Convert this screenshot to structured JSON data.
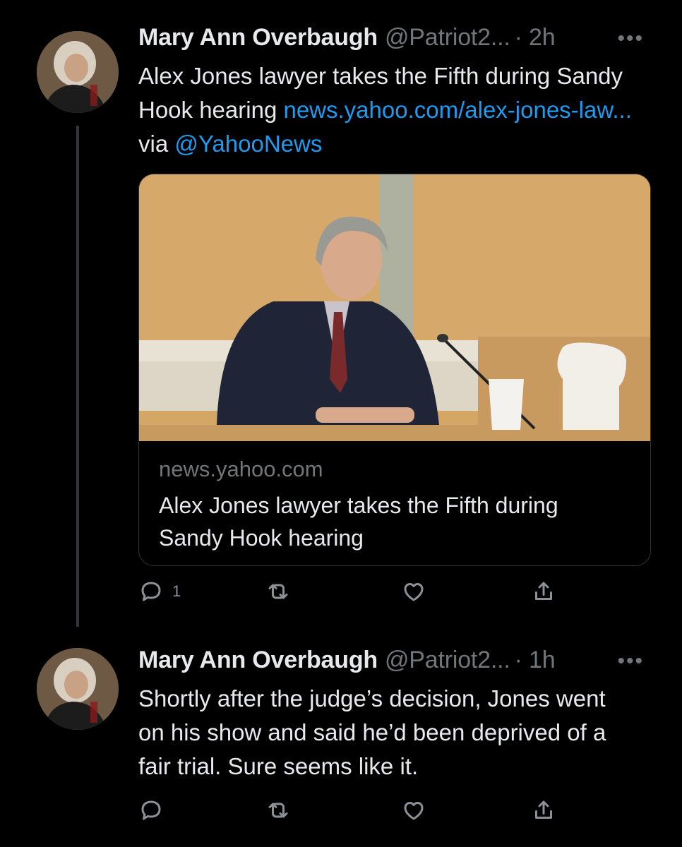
{
  "tweets": [
    {
      "author_name": "Mary Ann Overbaugh",
      "handle": "@Patriot2...",
      "time": "· 2h",
      "more": "•••",
      "text_1": "Alex Jones lawyer takes the Fifth during Sandy Hook hearing ",
      "link_1": "news.yahoo.com/alex-jones-law...",
      "text_2": " via ",
      "mention": "@YahooNews",
      "card": {
        "domain": "news.yahoo.com",
        "title": "Alex Jones lawyer takes the Fifth during Sandy Hook hearing"
      },
      "actions": {
        "reply_count": "1"
      }
    },
    {
      "author_name": "Mary Ann Overbaugh",
      "handle": "@Patriot2...",
      "time": "· 1h",
      "more": "•••",
      "text": "Shortly after the judge’s decision, Jones went on his show and said he’d been deprived of a fair trial. Sure seems like it."
    }
  ],
  "icons": [
    "reply-icon",
    "retweet-icon",
    "like-icon",
    "share-icon",
    "more-icon"
  ],
  "colors": {
    "background": "#000000",
    "text": "#e7e9ea",
    "muted": "#71767b",
    "link": "#1d9bf0"
  }
}
